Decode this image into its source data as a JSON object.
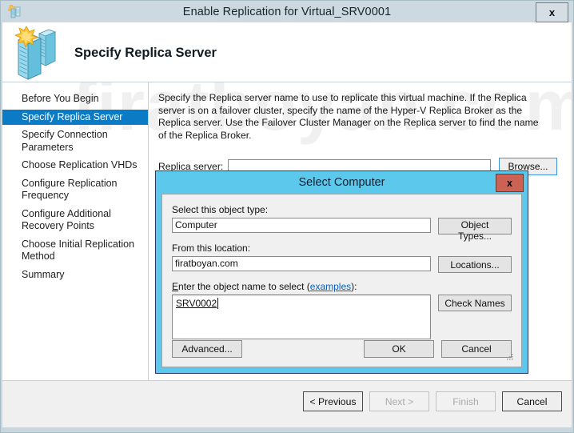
{
  "window": {
    "title": "Enable Replication for Virtual_SRV0001",
    "close_label": "x",
    "icon": "replication-wizard-icon"
  },
  "header": {
    "title": "Specify Replica Server",
    "icon": "two-servers-replication-icon"
  },
  "watermark": "firatboyan.com",
  "sidebar": {
    "items": [
      {
        "label": "Before You Begin",
        "selected": false
      },
      {
        "label": "Specify Replica Server",
        "selected": true
      },
      {
        "label": "Specify Connection Parameters",
        "selected": false
      },
      {
        "label": "Choose Replication VHDs",
        "selected": false
      },
      {
        "label": "Configure Replication Frequency",
        "selected": false
      },
      {
        "label": "Configure Additional Recovery Points",
        "selected": false
      },
      {
        "label": "Choose Initial Replication Method",
        "selected": false
      },
      {
        "label": "Summary",
        "selected": false
      }
    ]
  },
  "content": {
    "description": "Specify the Replica server name to use to replicate this virtual machine. If the Replica server is on a failover cluster, specify the name of the Hyper-V Replica Broker as the Replica server. Use the Failover Cluster Manager on the Replica server to find the name of the Replica Broker.",
    "replica_server_label": "Replica server:",
    "replica_server_value": "",
    "replica_server_placeholder": "",
    "browse_label": "Browse..."
  },
  "footer": {
    "previous_label": "< Previous",
    "next_label": "Next >",
    "finish_label": "Finish",
    "cancel_label": "Cancel",
    "next_enabled": false,
    "finish_enabled": false
  },
  "dialog": {
    "title": "Select Computer",
    "close_label": "x",
    "object_type_label": "Select this object type:",
    "object_type_value": "Computer",
    "object_types_button": "Object Types...",
    "location_label": "From this location:",
    "location_value": "firatboyan.com",
    "locations_button": "Locations...",
    "enter_name_label_pre": "E",
    "enter_name_label_rest": "nter the object name to select (",
    "examples_link": "examples",
    "enter_name_label_end": "):",
    "object_name_value": "SRV0002",
    "check_names_button": "Check Names",
    "advanced_button": "Advanced...",
    "ok_button": "OK",
    "cancel_button": "Cancel"
  },
  "colors": {
    "accent_selected": "#0a7bc4",
    "dialog_frame": "#5cc8ec",
    "close_red": "#cb6254",
    "titlebar": "#cdd9e0"
  }
}
